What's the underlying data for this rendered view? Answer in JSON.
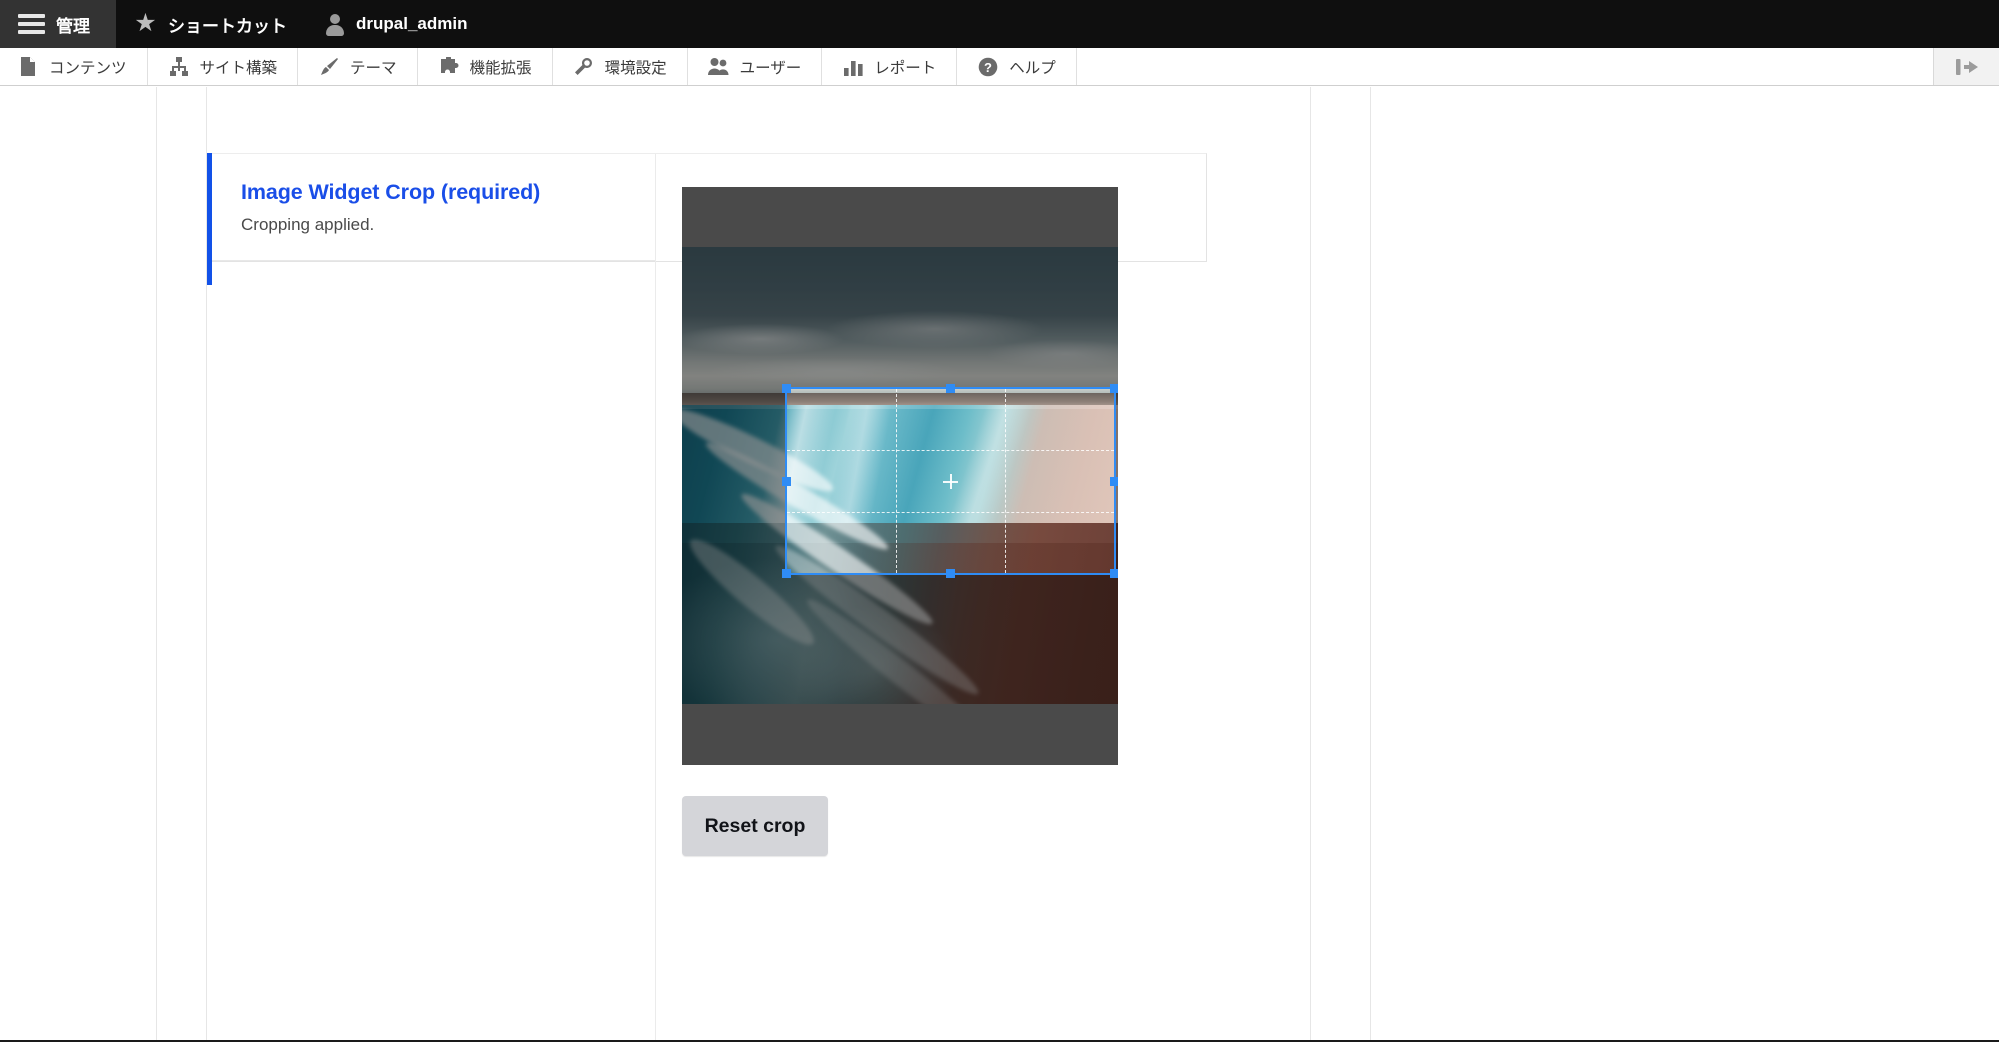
{
  "admin_bar": {
    "home_label": "管理",
    "home_icon": "hamburger-menu-icon",
    "shortcuts_label": "ショートカット",
    "shortcuts_icon": "star-icon",
    "account_label": "drupal_admin",
    "account_icon": "user-icon",
    "background": "#0f0f0f",
    "active_background": "#333333"
  },
  "menu_bar": {
    "items": [
      {
        "label": "コンテンツ",
        "icon": "document-icon"
      },
      {
        "label": "サイト構築",
        "icon": "sitemap-icon"
      },
      {
        "label": "テーマ",
        "icon": "paintbrush-icon"
      },
      {
        "label": "機能拡張",
        "icon": "puzzle-piece-icon"
      },
      {
        "label": "環境設定",
        "icon": "wrench-icon"
      },
      {
        "label": "ユーザー",
        "icon": "people-icon"
      },
      {
        "label": "レポート",
        "icon": "bar-chart-icon"
      },
      {
        "label": "ヘルプ",
        "icon": "question-circle-icon"
      }
    ],
    "collapse_icon": "collapse-panel-left-icon"
  },
  "widget": {
    "title": "Image Widget Crop (required)",
    "status_text": "Cropping applied.",
    "accent_color": "#1251e8",
    "title_color": "#1a4ee8"
  },
  "cropper": {
    "letterbox_color": "#808080",
    "selection_border_color": "#2f8cf5",
    "handle_color": "#2f8cf5",
    "overlay_shade": "rgba(0,0,0,0.42)",
    "grid": "rule-of-thirds",
    "center_marker": "crosshair",
    "handles": [
      "top-left",
      "top-center",
      "top-right",
      "middle-left",
      "middle-right",
      "bottom-left",
      "bottom-center",
      "bottom-right"
    ]
  },
  "actions": {
    "reset_crop_label": "Reset crop"
  }
}
